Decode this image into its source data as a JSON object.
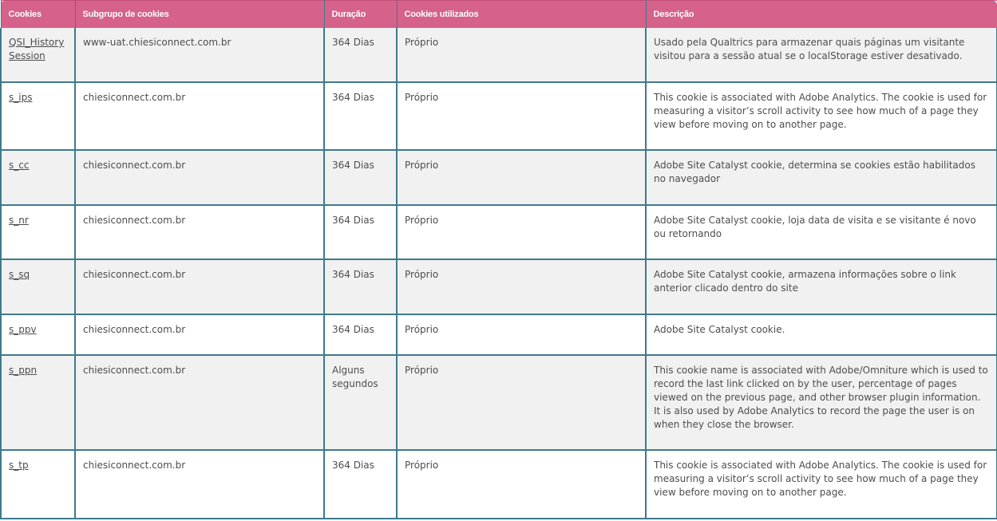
{
  "table": {
    "headers": [
      "Cookies",
      "Subgrupo de cookies",
      "Duração",
      "Cookies utilizados",
      "Descrição"
    ],
    "rows": [
      {
        "cookie": "QSI_History Session",
        "subgroup": "www-uat.chiesiconnect.com.br",
        "duration": "364 Dias",
        "used": "Próprio",
        "description": "Usado pela Qualtrics para armazenar quais páginas um visitante visitou para a sessão atual se o localStorage estiver desativado."
      },
      {
        "cookie": "s_ips",
        "subgroup": "chiesiconnect.com.br",
        "duration": "364 Dias",
        "used": "Próprio",
        "description": "This cookie is associated with Adobe Analytics. The cookie is used for measuring a visitor’s scroll activity to see how much of a page they view before moving on to another page."
      },
      {
        "cookie": "s_cc",
        "subgroup": "chiesiconnect.com.br",
        "duration": "364 Dias",
        "used": "Próprio",
        "description": "Adobe Site Catalyst cookie, determina se cookies estão habilitados no navegador"
      },
      {
        "cookie": "s_nr",
        "subgroup": "chiesiconnect.com.br",
        "duration": "364 Dias",
        "used": "Próprio",
        "description": "Adobe Site Catalyst cookie, loja data de visita e se visitante é novo ou retornando"
      },
      {
        "cookie": "s_sq",
        "subgroup": "chiesiconnect.com.br",
        "duration": "364 Dias",
        "used": "Próprio",
        "description": "Adobe Site Catalyst cookie, armazena informações sobre o link anterior clicado dentro do site"
      },
      {
        "cookie": "s_ppv",
        "subgroup": "chiesiconnect.com.br",
        "duration": "364 Dias",
        "used": "Próprio",
        "description": "Adobe Site Catalyst cookie."
      },
      {
        "cookie": "s_ppn",
        "subgroup": "chiesiconnect.com.br",
        "duration": "Alguns segundos",
        "used": "Próprio",
        "description": "This cookie name is associated with Adobe/Omniture which is used to record the last link clicked on by the user, percentage of pages viewed on the previous page, and other browser plugin information. It is also used by Adobe Analytics to record the page the user is on when they close the browser."
      },
      {
        "cookie": "s_tp",
        "subgroup": "chiesiconnect.com.br",
        "duration": "364 Dias",
        "used": "Próprio",
        "description": "This cookie is associated with Adobe Analytics. The cookie is used for measuring a visitor’s scroll activity to see how much of a page they view before moving on to another page."
      }
    ]
  }
}
